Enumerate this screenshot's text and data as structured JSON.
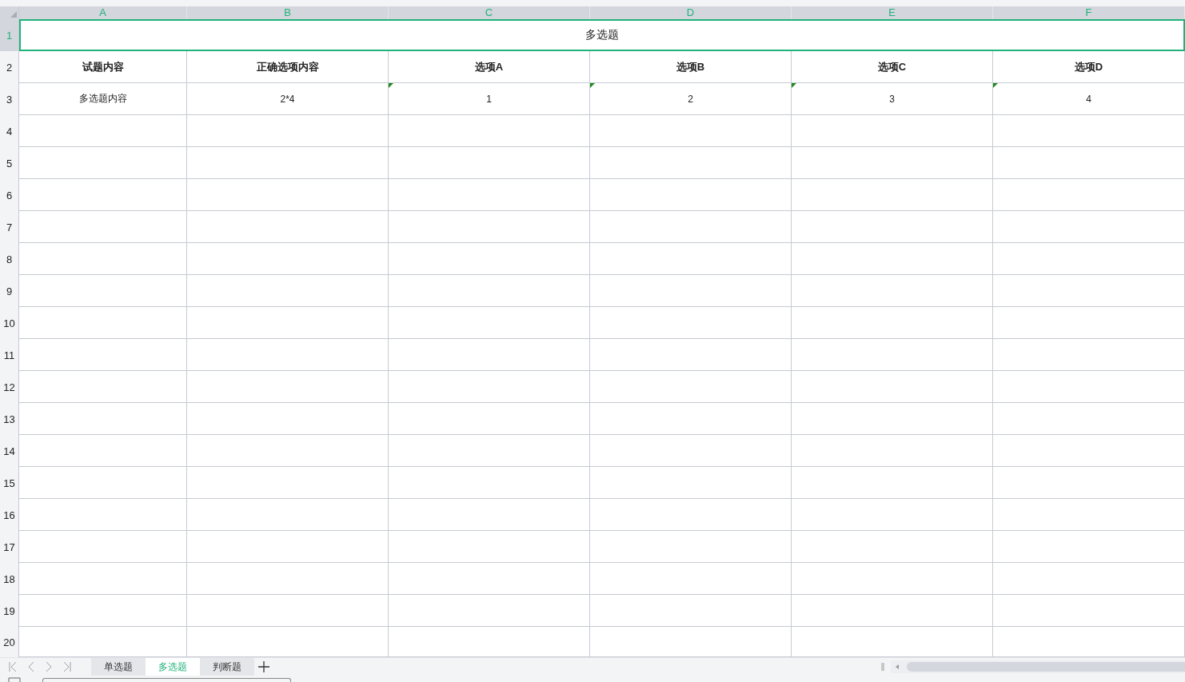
{
  "columns": [
    {
      "label": "A",
      "selected": true
    },
    {
      "label": "B",
      "selected": true
    },
    {
      "label": "C",
      "selected": true
    },
    {
      "label": "D",
      "selected": true
    },
    {
      "label": "E",
      "selected": true
    },
    {
      "label": "F",
      "selected": true
    }
  ],
  "title_row": {
    "number": "1",
    "text": "多选题",
    "selected": true
  },
  "header_row": {
    "number": "2",
    "cells": [
      "试题内容",
      "正确选项内容",
      "选项A",
      "选项B",
      "选项C",
      "选项D"
    ]
  },
  "data_rows": [
    {
      "number": "3",
      "cells": [
        {
          "text": "多选题内容",
          "flagged": false
        },
        {
          "text": "2*4",
          "flagged": false
        },
        {
          "text": "1",
          "flagged": true
        },
        {
          "text": "2",
          "flagged": true
        },
        {
          "text": "3",
          "flagged": true
        },
        {
          "text": "4",
          "flagged": true
        }
      ]
    }
  ],
  "empty_rows": [
    "4",
    "5",
    "6",
    "7",
    "8",
    "9",
    "10",
    "11",
    "12",
    "13",
    "14",
    "15",
    "16",
    "17",
    "18",
    "19",
    "20"
  ],
  "sheet_tabs": [
    {
      "label": "单选题",
      "selected": false
    },
    {
      "label": "多选题",
      "selected": true
    },
    {
      "label": "判断题",
      "selected": false
    }
  ]
}
